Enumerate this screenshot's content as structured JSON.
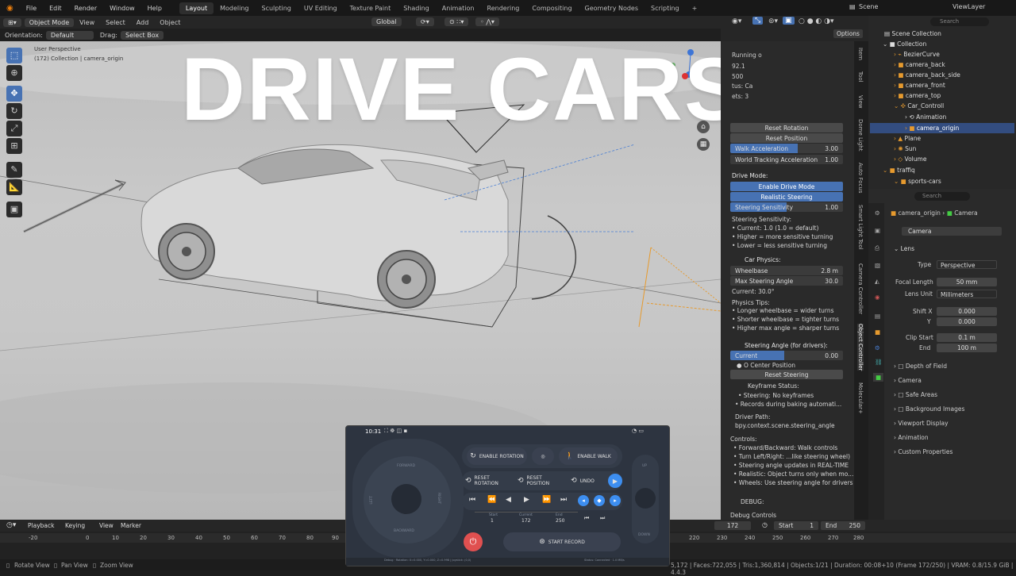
{
  "menu": [
    "File",
    "Edit",
    "Render",
    "Window",
    "Help"
  ],
  "workspaces": [
    "Layout",
    "Modeling",
    "Sculpting",
    "UV Editing",
    "Texture Paint",
    "Shading",
    "Animation",
    "Rendering",
    "Compositing",
    "Geometry Nodes",
    "Scripting"
  ],
  "active_workspace": "Layout",
  "scene": "Scene",
  "view_layer": "ViewLayer",
  "header": {
    "mode": "Object Mode",
    "view": "View",
    "select": "Select",
    "add": "Add",
    "object": "Object",
    "transform": "Global",
    "options": "Options"
  },
  "toolsettings": {
    "orientation_label": "Orientation:",
    "orientation": "Default",
    "drag_label": "Drag:",
    "drag": "Select Box"
  },
  "viewport": {
    "perspective": "User Perspective",
    "collection": "(172) Collection | camera_origin",
    "overlay_title": "DRIVE CARS"
  },
  "npanel": {
    "status_lines": [
      "Running o",
      "92.1",
      "500",
      "tus: Ca",
      "ets: 3"
    ],
    "buttons_top": [
      "Reset Rotation",
      "Reset Position"
    ],
    "walk_acc": {
      "label": "Walk Acceleration",
      "value": "3.00"
    },
    "world_acc": {
      "label": "World Tracking Acceleration",
      "value": "1.00"
    },
    "drive_mode": "Drive Mode:",
    "enable_drive": "Enable Drive Mode",
    "realistic": "Realistic Steering",
    "steer_sens": {
      "label": "Steering Sensitivity",
      "value": "1.00"
    },
    "sens_head": "Steering Sensitivity:",
    "sens_lines": [
      "• Current: 1.0 (1.0 = default)",
      "• Higher = more sensitive turning",
      "• Lower = less sensitive turning"
    ],
    "car_physics": "Car Physics:",
    "wheelbase": {
      "label": "Wheelbase",
      "value": "2.8 m"
    },
    "max_steer": {
      "label": "Max Steering Angle",
      "value": "30.0"
    },
    "current": "Current: 30.0°",
    "tips_head": "Physics Tips:",
    "tips": [
      "• Longer wheelbase = wider turns",
      "• Shorter wheelbase = tighter turns",
      "• Higher max angle = sharper turns"
    ],
    "steer_angle": "Steering Angle (for drivers):",
    "current_field": {
      "label": "Current",
      "value": "0.00"
    },
    "center": "O Center Position",
    "reset_steer": "Reset Steering",
    "kf_head": "Keyframe Status:",
    "kf_lines": [
      "• Steering: No keyframes",
      "• Records during baking automati..."
    ],
    "driver_head": "Driver Path:",
    "driver_path": "bpy.context.scene.steering_angle",
    "controls_head": "Controls:",
    "controls": [
      "• Forward/Backward: Walk controls",
      "• Turn Left/Right: ...like steering wheel)",
      "• Steering angle updates in REAL-TIME",
      "• Realistic: Object turns only when mo...",
      "• Wheels: Use steering angle for drivers"
    ],
    "debug": "DEBUG:",
    "debug_controls": "Debug Controls"
  },
  "vtabs": [
    "Item",
    "Tool",
    "View",
    "Dome Light",
    "Auto Focus",
    "Smart Light Tool",
    "Camera Controller",
    "Object Controller",
    "Molecular+"
  ],
  "outliner": {
    "search": "Search",
    "root": "Scene Collection",
    "items": [
      "Collection",
      "BezierCurve",
      "camera_back",
      "camera_back_side",
      "camera_front",
      "camera_top",
      "Car_Controll",
      "Animation",
      "camera_origin",
      "Plane",
      "Sun",
      "Volume",
      "traffiq",
      "sports-cars"
    ]
  },
  "props": {
    "search": "Search",
    "breadcrumb_obj": "camera_origin",
    "breadcrumb_data": "Camera",
    "datablock": "Camera",
    "lens": "Lens",
    "type": {
      "label": "Type",
      "value": "Perspective"
    },
    "focal": {
      "label": "Focal Length",
      "value": "50 mm"
    },
    "lens_unit": {
      "label": "Lens Unit",
      "value": "Millimeters"
    },
    "shift_x": {
      "label": "Shift X",
      "value": "0.000"
    },
    "shift_y": {
      "label": "Y",
      "value": "0.000"
    },
    "clip_start": {
      "label": "Clip Start",
      "value": "0.1 m"
    },
    "clip_end": {
      "label": "End",
      "value": "100 m"
    },
    "panels": [
      "Depth of Field",
      "Camera",
      "Safe Areas",
      "Background Images",
      "Viewport Display",
      "Animation",
      "Custom Properties"
    ]
  },
  "timeline": {
    "menus": [
      "Playback",
      "Keying",
      "View",
      "Marker"
    ],
    "frame": "172",
    "start_label": "Start",
    "start": "1",
    "end_label": "End",
    "end": "250",
    "ticks": [
      "-20",
      "0",
      "10",
      "20",
      "30",
      "40",
      "50",
      "60",
      "70",
      "80",
      "90",
      "220",
      "230",
      "240",
      "250",
      "260",
      "270",
      "280"
    ]
  },
  "status": {
    "left": [
      "Rotate View",
      "Pan View",
      "Zoom View"
    ],
    "right": "5,172 | Faces:722,055 | Tris:1,360,814 | Objects:1/21 | Duration: 00:08+10 (Frame 172/250) | VRAM: 0.8/15.9 GiB | 4.4.3"
  },
  "remote": {
    "time": "10:31",
    "forward": "FORWARD",
    "backward": "BACKWARD",
    "left": "LEFT",
    "right": "RIGHT",
    "up": "UP",
    "down": "DOWN",
    "enable_rotation": "ENABLE ROTATION",
    "enable_walk": "ENABLE WALK",
    "reset_rotation": "RESET ROTATION",
    "reset_position": "RESET POSITION",
    "undo": "UNDO",
    "start_lbl": "Start",
    "start": "1",
    "current_lbl": "Current",
    "current": "172",
    "end_lbl": "End",
    "end": "250",
    "start_record": "START RECORD",
    "debug": "Debug · Rotation: X=0.000, Y=0.000, Z=0.998 | Joystick: (0,0)",
    "status": "Status: Connected · 1.0 MB/s"
  }
}
